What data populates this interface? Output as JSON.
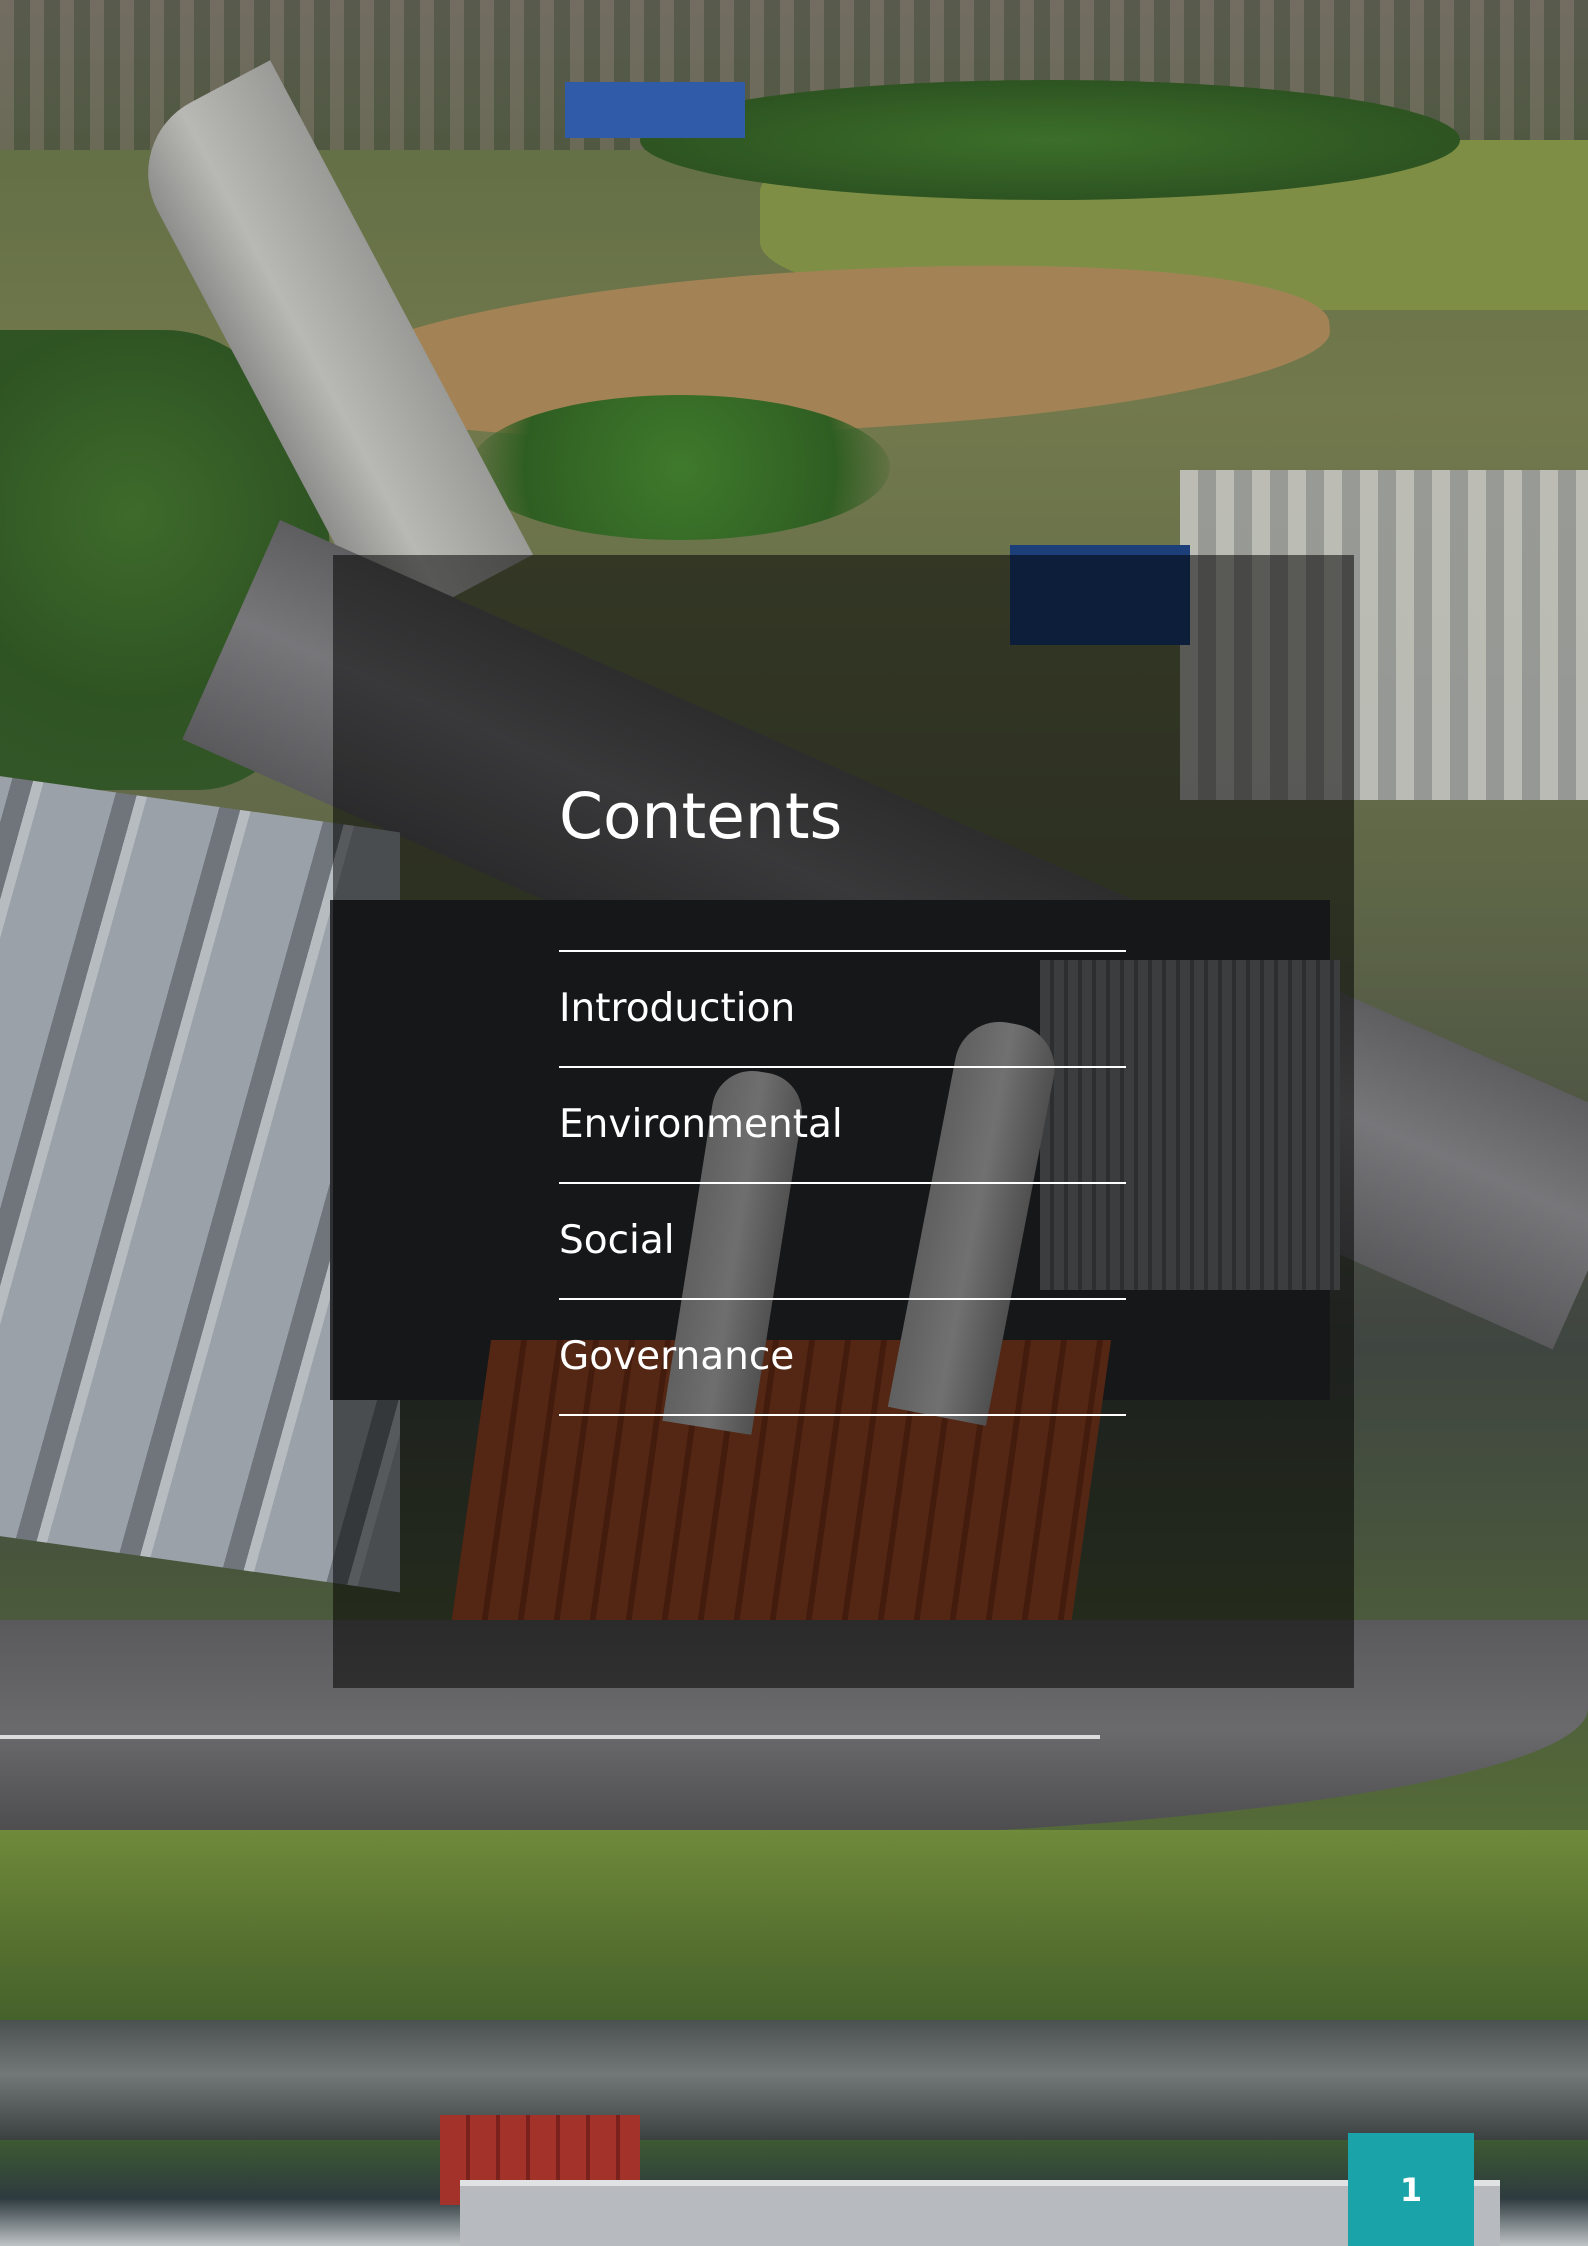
{
  "contents": {
    "title": "Contents",
    "items": [
      {
        "label": "Introduction"
      },
      {
        "label": "Environmental"
      },
      {
        "label": "Social"
      },
      {
        "label": "Governance"
      }
    ]
  },
  "page_number": "1",
  "colors": {
    "accent": "#1aa3a8",
    "overlay": "rgba(0,0,0,0.52)",
    "text": "#ffffff"
  },
  "background_image": {
    "icon": "aerial-photo-image"
  }
}
